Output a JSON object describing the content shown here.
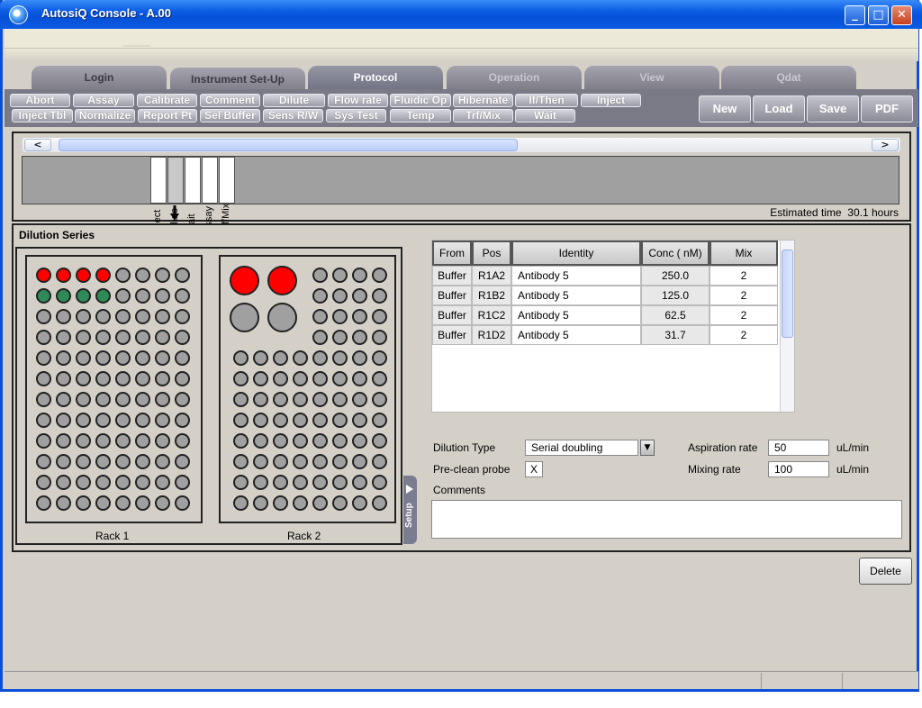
{
  "window": {
    "title": "AutosiQ Console - A.00"
  },
  "tabs": [
    {
      "label": "Login",
      "state": "normal"
    },
    {
      "label": "Instrument Set-Up",
      "state": "normal"
    },
    {
      "label": "Protocol",
      "state": "active"
    },
    {
      "label": "Operation",
      "state": "disabled"
    },
    {
      "label": "View",
      "state": "disabled"
    },
    {
      "label": "Qdat",
      "state": "disabled"
    }
  ],
  "commands": {
    "row1": [
      "Abort",
      "Assay",
      "Calibrate",
      "Comment",
      "Dilute",
      "Flow rate",
      "Fluidic Op",
      "Hibernate",
      "If/Then",
      "Inject"
    ],
    "row2": [
      "Inject Tbl",
      "Normalize",
      "Report Pt",
      "Sel Buffer",
      "Sens R/W",
      "Sys Test",
      "Temp",
      "Trf/Mix",
      "Wait"
    ]
  },
  "file_buttons": {
    "new": "New",
    "load": "Load",
    "save": "Save",
    "pdf": "PDF"
  },
  "timeline": {
    "scroll_left": "<",
    "scroll_right": ">",
    "steps": [
      "Inject",
      "Dilute",
      "Wait",
      "Assay",
      "Trf/Mix"
    ],
    "selected_step": "Dilute",
    "estimated_label": "Estimated time",
    "estimated_value": "30.1 hours"
  },
  "panel": {
    "title": "Dilution Series",
    "setup_tab": "Setup"
  },
  "racks": [
    {
      "label": "Rack 1",
      "red_count": 4,
      "green_count": 4
    },
    {
      "label": "Rack 2",
      "large_red_count": 2,
      "large_gray_count": 2
    }
  ],
  "table": {
    "headers": [
      "From",
      "Pos",
      "Identity",
      "Conc ( nM)",
      "Mix"
    ],
    "rows": [
      [
        "Buffer",
        "R1A2",
        "Antibody 5",
        "250.0",
        "2"
      ],
      [
        "Buffer",
        "R1B2",
        "Antibody 5",
        "125.0",
        "2"
      ],
      [
        "Buffer",
        "R1C2",
        "Antibody 5",
        "62.5",
        "2"
      ],
      [
        "Buffer",
        "R1D2",
        "Antibody 5",
        "31.7",
        "2"
      ]
    ]
  },
  "form": {
    "dilution_type_label": "Dilution Type",
    "dilution_type_value": "Serial doubling",
    "preclean_label": "Pre-clean probe",
    "preclean_value": "X",
    "aspiration_label": "Aspiration rate",
    "aspiration_value": "50",
    "aspiration_unit": "uL/min",
    "mixing_label": "Mixing rate",
    "mixing_value": "100",
    "mixing_unit": "uL/min",
    "comments_label": "Comments",
    "comments_value": ""
  },
  "delete_label": "Delete",
  "colors": {
    "titlebar": "#0a5be3",
    "tabbar": "#7a7a86",
    "well_red": "#ff0000",
    "well_green": "#2e8b57",
    "well_gray": "#a0a0a0"
  }
}
